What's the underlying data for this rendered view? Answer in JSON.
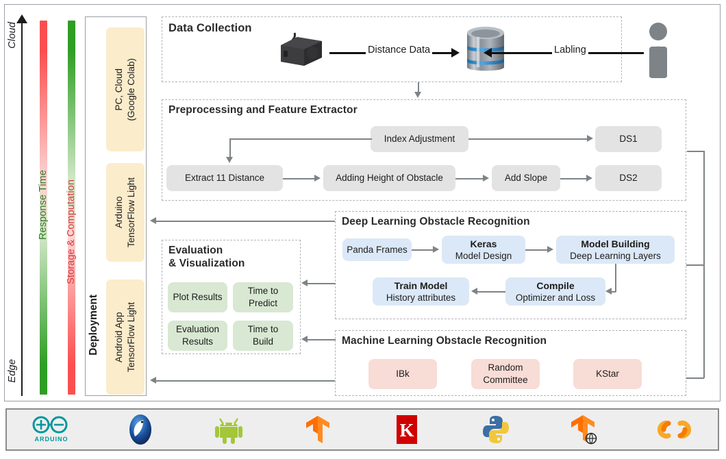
{
  "axis": {
    "top_label": "Cloud",
    "bottom_label": "Edge"
  },
  "bars": [
    {
      "name": "response-time",
      "label": "Response Time",
      "text_color": "#2f7d24",
      "top_color": "#fb4f4f",
      "bottom_color": "#2f9e24"
    },
    {
      "name": "storage-computation",
      "label": "Storage & Computation",
      "text_color": "#d73c3c",
      "top_color": "#2f9e24",
      "bottom_color": "#fb4f4f"
    }
  ],
  "deployment": {
    "title": "Deployment",
    "boxes": [
      {
        "label": "PC, Cloud\n(Google Colab)"
      },
      {
        "label": "Arduino\nTensorFlow Light"
      },
      {
        "label": "Android App\nTensorFlow Light"
      }
    ],
    "box_color": "#fbeccb"
  },
  "data_collection": {
    "title": "Data Collection",
    "sensor_icon": "distance-sensor-icon",
    "database_icon": "database-cylinder-icon",
    "person_icon": "person-icon",
    "arrow_labels": {
      "sensor_to_db": "Distance Data",
      "person_to_db": "Labling"
    }
  },
  "preprocessing": {
    "title": "Preprocessing and Feature Extractor",
    "box_color": "#e3e3e3",
    "nodes": [
      {
        "id": "index-adjustment",
        "label": "Index Adjustment"
      },
      {
        "id": "ds1",
        "label": "DS1"
      },
      {
        "id": "extract-11-distance",
        "label": "Extract 11 Distance"
      },
      {
        "id": "adding-height-of-obstacle",
        "label": "Adding Height of Obstacle"
      },
      {
        "id": "add-slope",
        "label": "Add Slope"
      },
      {
        "id": "ds2",
        "label": "DS2"
      }
    ]
  },
  "deep_learning": {
    "title": "Deep Learning Obstacle Recognition",
    "box_color": "#dbe8f7",
    "nodes": [
      {
        "id": "panda-frames",
        "title": "",
        "sub": "Panda Frames"
      },
      {
        "id": "keras",
        "title": "Keras",
        "sub": "Model Design"
      },
      {
        "id": "model-building",
        "title": "Model Building",
        "sub": "Deep Learning Layers"
      },
      {
        "id": "compile",
        "title": "Compile",
        "sub": "Optimizer and Loss"
      },
      {
        "id": "train-model",
        "title": "Train Model",
        "sub": "History attributes"
      }
    ]
  },
  "machine_learning": {
    "title": "Machine Learning Obstacle Recognition",
    "box_color": "#f8dcd6",
    "nodes": [
      {
        "id": "ibk",
        "label": "IBk"
      },
      {
        "id": "random-committee",
        "label": "Random\nCommittee"
      },
      {
        "id": "kstar",
        "label": "KStar"
      }
    ]
  },
  "evaluation": {
    "title": "Evaluation\n& Visualization",
    "box_color": "#d8e8d2",
    "nodes": [
      {
        "id": "plot-results",
        "label": "Plot Results"
      },
      {
        "id": "time-to-predict",
        "label": "Time to\nPredict"
      },
      {
        "id": "evaluation-results",
        "label": "Evaluation\nResults"
      },
      {
        "id": "time-to-build",
        "label": "Time to\nBuild"
      }
    ]
  },
  "logo_bar": {
    "logos": [
      {
        "id": "arduino-logo",
        "name": "Arduino",
        "color": "#00979c"
      },
      {
        "id": "weka-logo",
        "name": "Weka",
        "color": "#1a3d8f"
      },
      {
        "id": "android-logo",
        "name": "Android",
        "color": "#a4c639"
      },
      {
        "id": "tensorflow-logo",
        "name": "TensorFlow",
        "color": "#ff6f00"
      },
      {
        "id": "keras-logo",
        "name": "Keras",
        "color": "#d00000"
      },
      {
        "id": "python-logo",
        "name": "Python",
        "color": "#3776ab"
      },
      {
        "id": "tensorflow-lite-logo",
        "name": "TensorFlow Lite",
        "color": "#ff6f00"
      },
      {
        "id": "google-colab-logo",
        "name": "Google Colab",
        "color": "#f9a825"
      }
    ]
  }
}
